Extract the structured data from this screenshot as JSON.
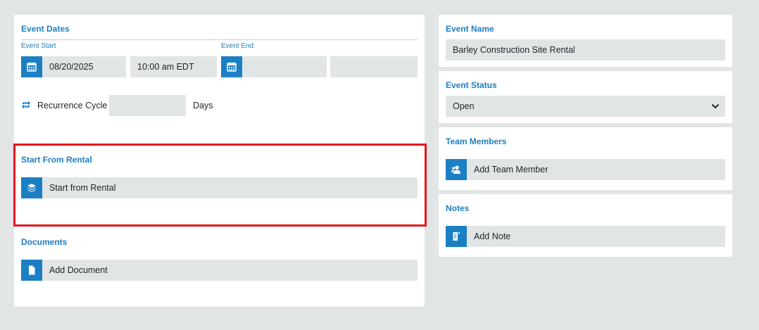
{
  "event_dates": {
    "title": "Event Dates",
    "start_label": "Event Start",
    "end_label": "Event End",
    "start_date": "08/20/2025",
    "start_time": "10:00 am EDT",
    "end_date": "",
    "end_time": ""
  },
  "recurrence": {
    "label": "Recurrence Cycle",
    "value": "",
    "unit": "Days"
  },
  "start_from_rental": {
    "title": "Start From Rental",
    "button_label": "Start from Rental"
  },
  "documents": {
    "title": "Documents",
    "button_label": "Add Document"
  },
  "event_name": {
    "title": "Event Name",
    "value": "Barley Construction Site Rental"
  },
  "event_status": {
    "title": "Event Status",
    "value": "Open"
  },
  "team_members": {
    "title": "Team Members",
    "button_label": "Add Team Member"
  },
  "notes": {
    "title": "Notes",
    "button_label": "Add Note"
  },
  "colors": {
    "accent": "#1b7fc4",
    "highlight": "#e5161c",
    "field_bg": "#e2e5e6"
  }
}
